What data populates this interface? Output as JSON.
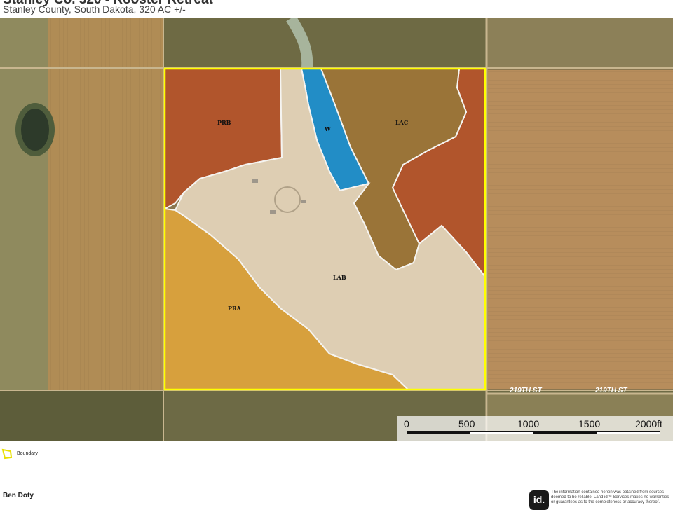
{
  "header": {
    "title": "Stanley Co. 320 - Rooster Retreat",
    "subtitle": "Stanley County, South Dakota, 320 AC +/-"
  },
  "map": {
    "soil_units": [
      {
        "code": "PRB",
        "color": "#b5532a"
      },
      {
        "code": "W",
        "color": "#1a8fd0"
      },
      {
        "code": "LAC",
        "color": "#9c7436"
      },
      {
        "code": "LAB",
        "color": "#e6d6bc"
      },
      {
        "code": "PRA",
        "color": "#dea43c"
      }
    ],
    "roads": [
      "219TH ST",
      "219TH ST"
    ],
    "boundary_color": "#ffff00",
    "scale": {
      "ticks": [
        "0",
        "500",
        "1000",
        "1500",
        "2000ft"
      ]
    }
  },
  "legend": {
    "items": [
      {
        "label": "Boundary",
        "icon": "boundary-icon"
      }
    ]
  },
  "footer": {
    "agent": "Ben Doty",
    "logo_text": "id.",
    "disclaimer": "The information contained herein was obtained from sources deemed to be reliable. Land id™ Services makes no warranties or guarantees as to the completeness or accuracy thereof."
  }
}
